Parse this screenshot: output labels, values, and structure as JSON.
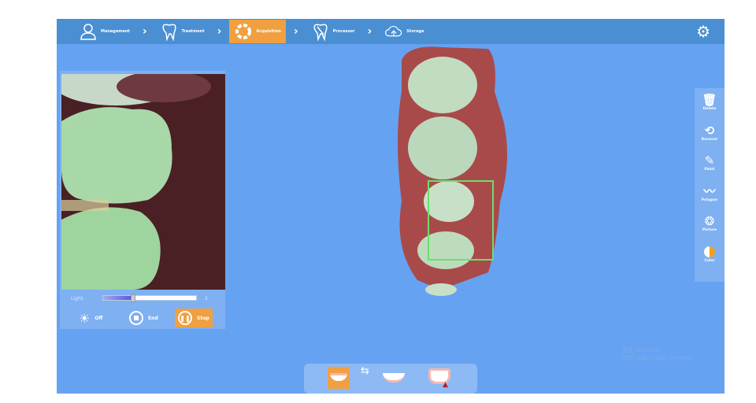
{
  "header": {
    "steps": [
      {
        "label": "Management",
        "icon": "user-icon"
      },
      {
        "label": "Treatment",
        "icon": "tooth-icon"
      },
      {
        "label": "Acquisition",
        "icon": "acquisition-ring-icon",
        "active": true
      },
      {
        "label": "Processor",
        "icon": "tooth-tool-icon"
      },
      {
        "label": "Storage",
        "icon": "cloud-upload-icon"
      }
    ],
    "settings_icon": "gear-icon"
  },
  "camera": {
    "light_label": "Light:",
    "light_value": "2",
    "light_fraction": 0.3,
    "off_label": "Off",
    "end_label": "End",
    "stop_label": "Stop"
  },
  "tools": [
    {
      "label": "Delete",
      "icon": "trash-icon"
    },
    {
      "label": "Recover",
      "icon": "recover-icon"
    },
    {
      "label": "Paint",
      "icon": "brush-icon"
    },
    {
      "label": "Polygon",
      "icon": "polygon-icon"
    },
    {
      "label": "Picture",
      "icon": "aperture-icon"
    },
    {
      "label": "Color",
      "icon": "color-icon"
    }
  ],
  "bottom": {
    "jaws": [
      "upper-jaw",
      "lower-jaw",
      "bite"
    ]
  },
  "watermark": {
    "line1": "激活 Windows",
    "line2": "转到“设置”以激活 Windows。"
  },
  "colors": {
    "header": "#4a8fd2",
    "bg": "#66a2f2",
    "active": "#f0a040"
  }
}
